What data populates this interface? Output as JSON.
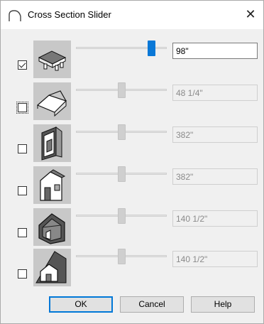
{
  "window": {
    "title": "Cross Section Slider"
  },
  "rows": [
    {
      "checked": true,
      "value": "98\"",
      "enabled": true,
      "icon": "floor-platform-section-icon",
      "slider_position": 0.86
    },
    {
      "checked": false,
      "value": "48 1/4\"",
      "enabled": false,
      "icon": "roof-section-icon",
      "slider_position": 0.5
    },
    {
      "checked": false,
      "value": "382\"",
      "enabled": false,
      "icon": "wall-cutaway-section-icon",
      "slider_position": 0.5
    },
    {
      "checked": false,
      "value": "382\"",
      "enabled": false,
      "icon": "house-side-section-icon",
      "slider_position": 0.5
    },
    {
      "checked": false,
      "value": "140 1/2\"",
      "enabled": false,
      "icon": "house-frame-section-icon",
      "slider_position": 0.5
    },
    {
      "checked": false,
      "value": "140 1/2\"",
      "enabled": false,
      "icon": "house-diagonal-section-icon",
      "slider_position": 0.5
    }
  ],
  "buttons": {
    "ok": "OK",
    "cancel": "Cancel",
    "help": "Help"
  }
}
